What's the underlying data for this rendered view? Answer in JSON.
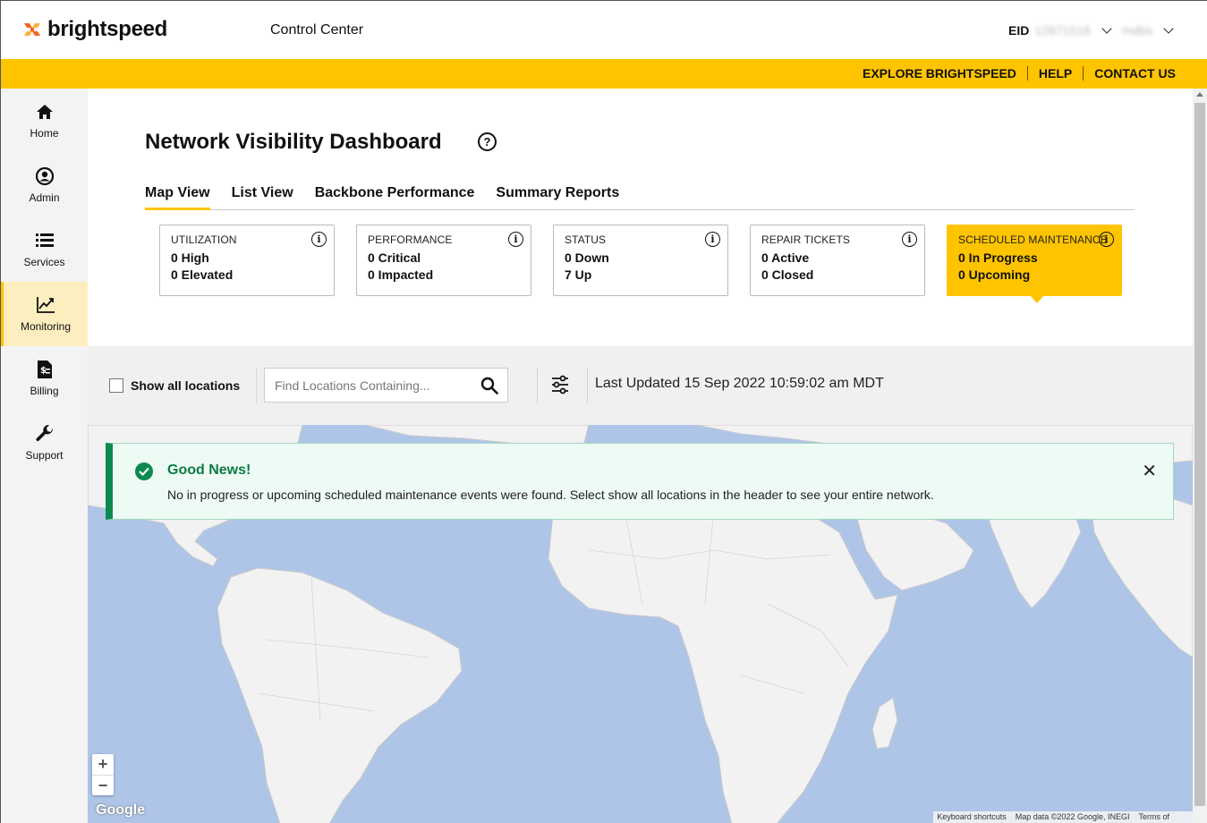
{
  "header": {
    "logo_text": "brightspeed",
    "app_title": "Control Center",
    "eid_label": "EID",
    "eid_value": "12871518",
    "user_name": "mdbs"
  },
  "utility_nav": {
    "items": [
      "EXPLORE BRIGHTSPEED",
      "HELP",
      "CONTACT US"
    ]
  },
  "sidebar": {
    "items": [
      {
        "label": "Home",
        "icon": "home-icon"
      },
      {
        "label": "Admin",
        "icon": "user-icon"
      },
      {
        "label": "Services",
        "icon": "list-icon"
      },
      {
        "label": "Monitoring",
        "icon": "chart-icon",
        "active": true
      },
      {
        "label": "Billing",
        "icon": "invoice-icon"
      },
      {
        "label": "Support",
        "icon": "wrench-icon"
      }
    ]
  },
  "page": {
    "title": "Network Visibility Dashboard",
    "help_glyph": "?",
    "tabs": [
      "Map View",
      "List View",
      "Backbone Performance",
      "Summary Reports"
    ],
    "active_tab": "Map View"
  },
  "cards": [
    {
      "title": "UTILIZATION",
      "line1": "0 High",
      "line2": "0 Elevated"
    },
    {
      "title": "PERFORMANCE",
      "line1": "0 Critical",
      "line2": "0 Impacted"
    },
    {
      "title": "STATUS",
      "line1": "0 Down",
      "line2": "7 Up"
    },
    {
      "title": "REPAIR TICKETS",
      "line1": "0 Active",
      "line2": "0 Closed"
    },
    {
      "title": "SCHEDULED MAINTENANCE",
      "line1": "0 In Progress",
      "line2": "0 Upcoming",
      "active": true
    }
  ],
  "filters": {
    "show_all_label": "Show all locations",
    "show_all_checked": false,
    "search_placeholder": "Find Locations Containing...",
    "search_value": "",
    "last_updated": "Last Updated 15 Sep 2022 10:59:02 am MDT"
  },
  "alert": {
    "title": "Good News!",
    "message": "No in progress or upcoming scheduled maintenance events were found. Select show all locations in the header to see your entire network.",
    "close_glyph": "✕"
  },
  "map": {
    "zoom_in": "+",
    "zoom_out": "−",
    "provider": "Google",
    "attributions": [
      "Keyboard shortcuts",
      "Map data ©2022 Google, INEGI",
      "Terms of"
    ],
    "water_color": "#aec5e8",
    "land_color": "#f2f2f2"
  },
  "colors": {
    "brand_yellow": "#ffc400",
    "success_green": "#0e8a50",
    "logo_orange": "#f26522"
  }
}
